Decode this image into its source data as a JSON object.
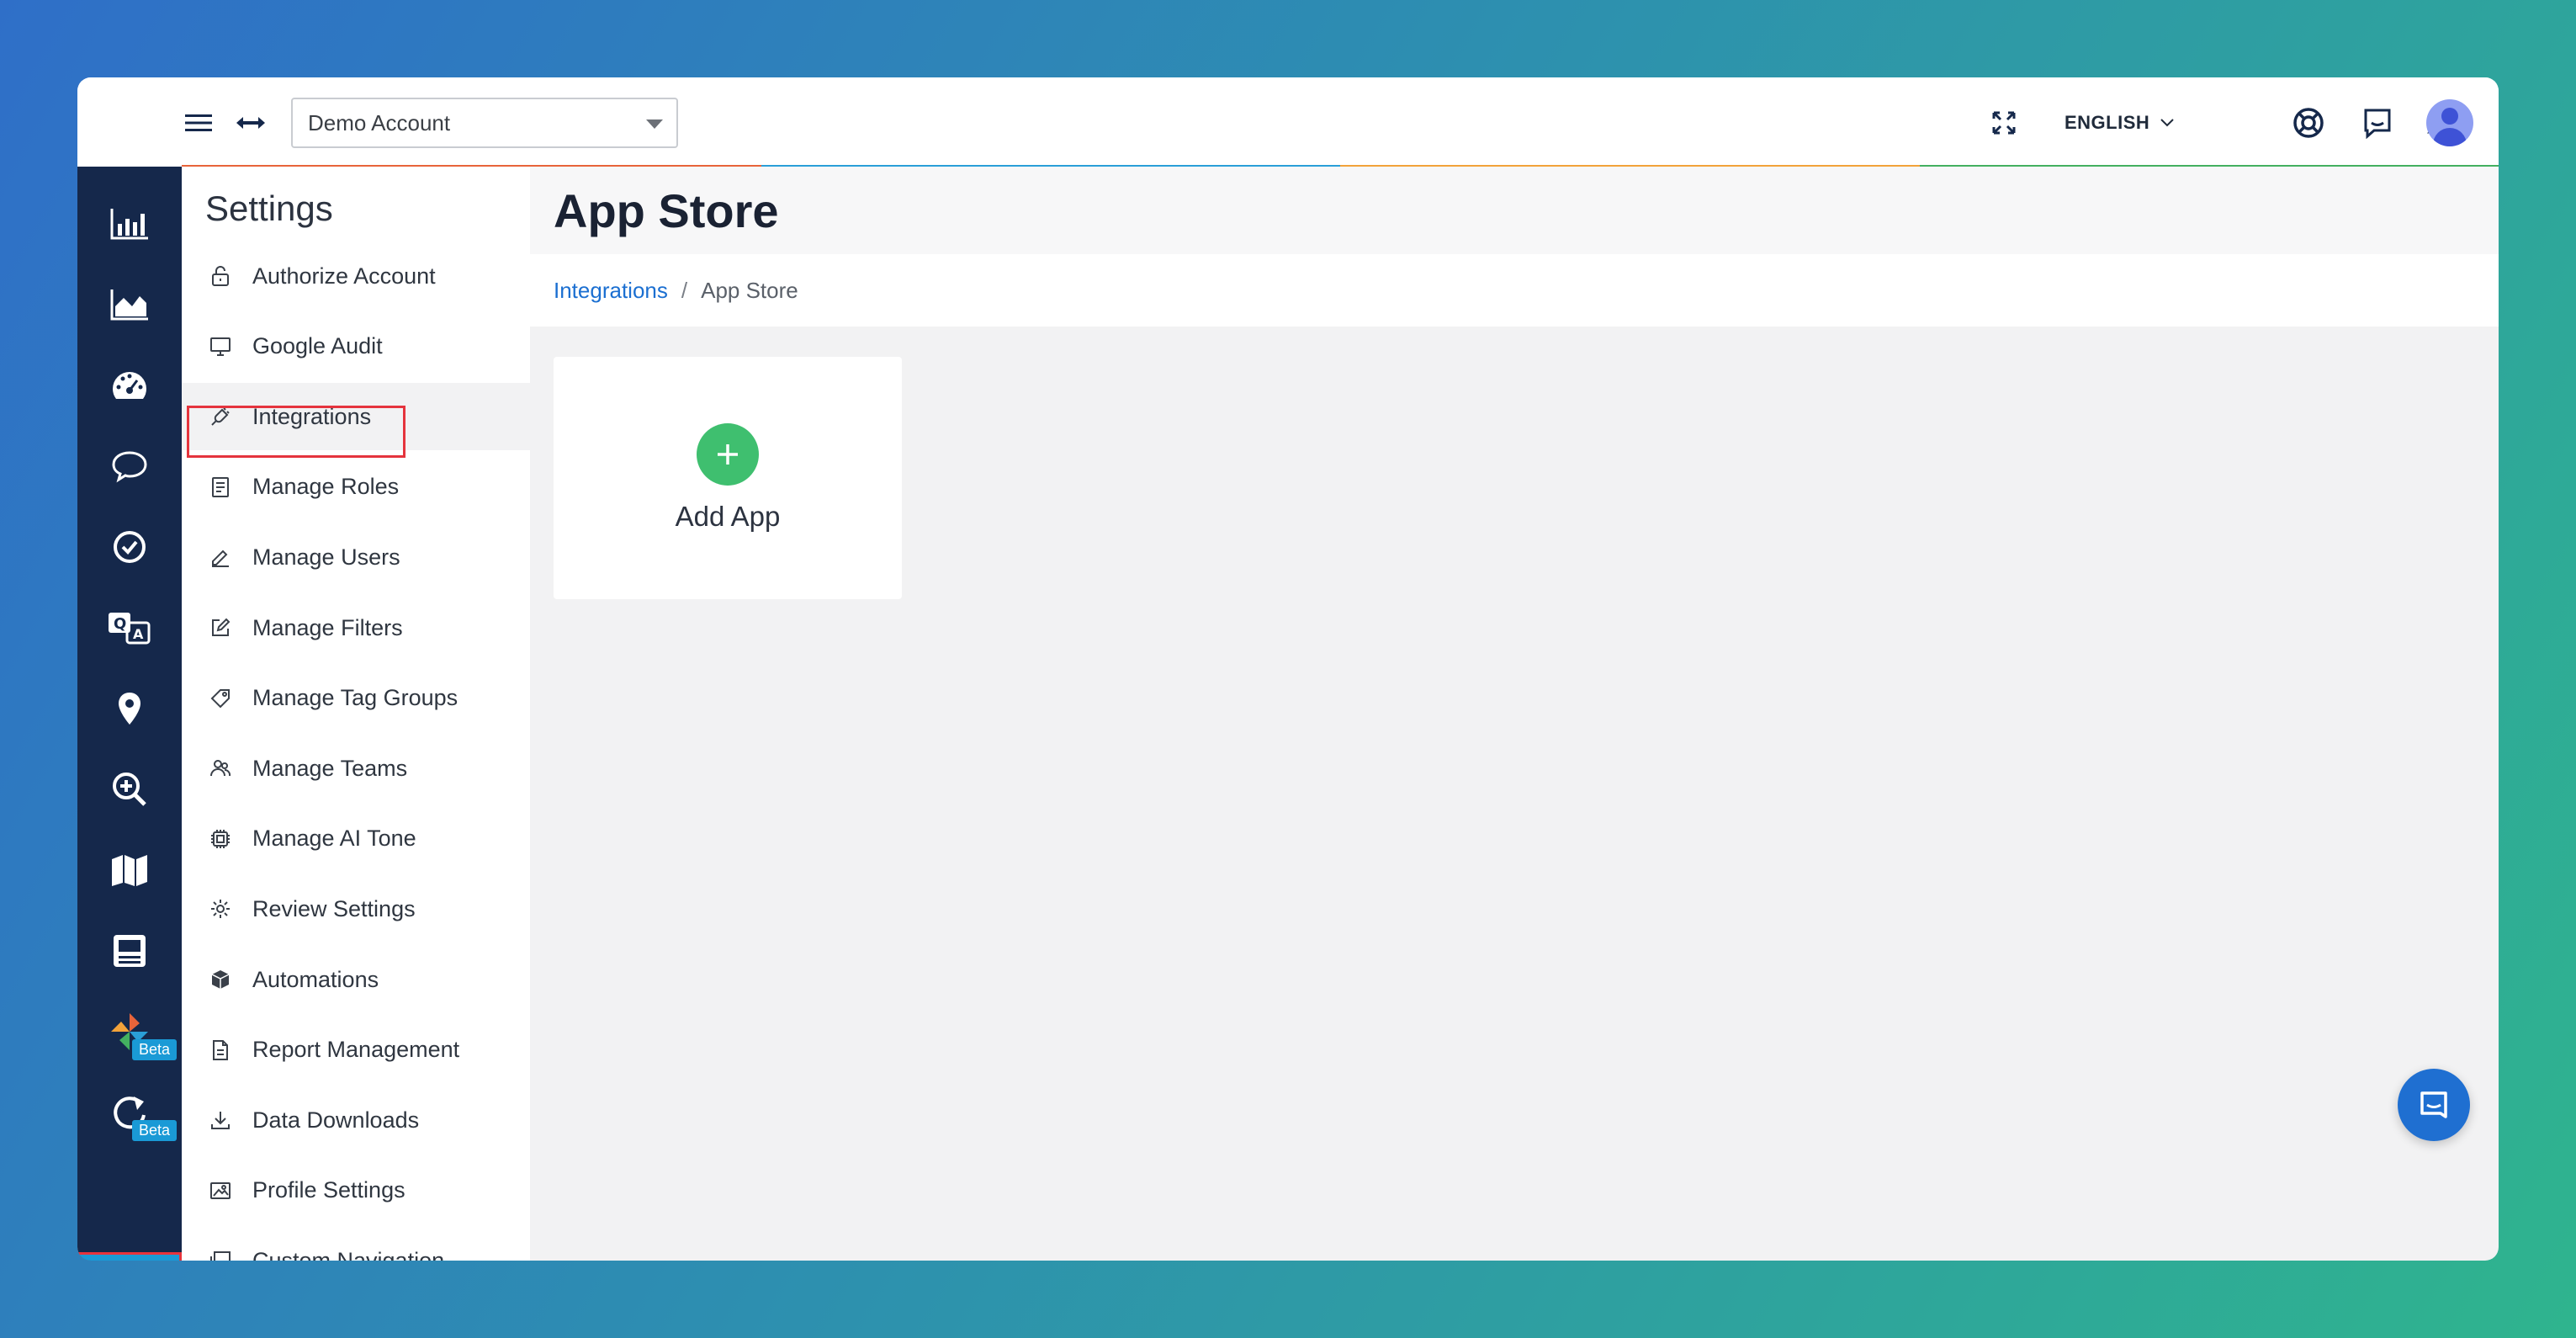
{
  "header": {
    "account_select": "Demo Account",
    "language": "ENGLISH",
    "stripe_colors": [
      "#e8643a",
      "#2a9fd8",
      "#f2a23a",
      "#43b060"
    ]
  },
  "settings": {
    "title": "Settings",
    "items": [
      {
        "label": "Authorize Account",
        "icon": "lock-icon"
      },
      {
        "label": "Google Audit",
        "icon": "monitor-icon"
      },
      {
        "label": "Integrations",
        "icon": "plug-icon",
        "selected": true
      },
      {
        "label": "Manage Roles",
        "icon": "document-icon"
      },
      {
        "label": "Manage Users",
        "icon": "pencil-icon"
      },
      {
        "label": "Manage Filters",
        "icon": "edit-icon"
      },
      {
        "label": "Manage Tag Groups",
        "icon": "tag-icon"
      },
      {
        "label": "Manage Teams",
        "icon": "team-icon"
      },
      {
        "label": "Manage AI Tone",
        "icon": "chip-icon"
      },
      {
        "label": "Review Settings",
        "icon": "gear-icon"
      },
      {
        "label": "Automations",
        "icon": "cube-icon"
      },
      {
        "label": "Report Management",
        "icon": "report-icon"
      },
      {
        "label": "Data Downloads",
        "icon": "download-icon"
      },
      {
        "label": "Profile Settings",
        "icon": "image-icon"
      },
      {
        "label": "Custom Navigation",
        "icon": "window-icon"
      }
    ]
  },
  "rail": {
    "beta_label": "Beta"
  },
  "page": {
    "title": "App Store",
    "breadcrumb": {
      "link": "Integrations",
      "separator": "/",
      "current": "App Store"
    },
    "card": {
      "label": "Add App"
    }
  },
  "colors": {
    "rail_bg": "#15284b",
    "accent": "#1a9ad6",
    "add_green": "#3fbf6f",
    "highlight": "#e5343d"
  }
}
